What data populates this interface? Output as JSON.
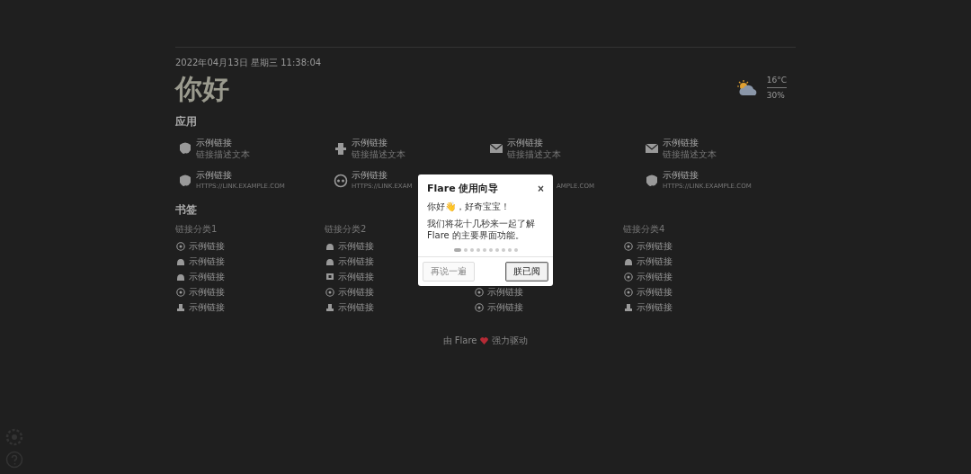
{
  "header": {
    "datetime": "2022年04月13日 星期三 11:38:04",
    "greeting": "你好",
    "weather": {
      "temperature": "16°C",
      "humidity": "30%"
    }
  },
  "apps": {
    "title": "应用",
    "items": [
      {
        "kind": "link",
        "title": "示例链接",
        "description": "链接描述文本"
      },
      {
        "kind": "link",
        "title": "示例链接",
        "description": "链接描述文本"
      },
      {
        "kind": "link",
        "title": "示例链接",
        "description": "链接描述文本"
      },
      {
        "kind": "link",
        "title": "示例链接",
        "description": "链接描述文本"
      },
      {
        "kind": "link",
        "title": "示例链接",
        "description": "HTTPS://LINK.EXAMPLE.COM"
      },
      {
        "kind": "link",
        "title": "示例链接",
        "description": "HTTPS://LINK.EXAM"
      },
      {
        "kind": "fragment",
        "description": "AMPLE.COM"
      },
      {
        "kind": "link",
        "title": "示例链接",
        "description": "HTTPS://LINK.EXAMPLE.COM"
      }
    ]
  },
  "bookmarks": {
    "title": "书签",
    "groups": [
      {
        "title": "链接分类1",
        "links": [
          "示例链接",
          "示例链接",
          "示例链接",
          "示例链接",
          "示例链接"
        ]
      },
      {
        "title": "链接分类2",
        "links": [
          "示例链接",
          "示例链接",
          "示例链接",
          "示例链接",
          "示例链接"
        ]
      },
      {
        "links": [
          "示例链接",
          "示例链接"
        ]
      },
      {
        "title": "链接分类4",
        "links": [
          "示例链接",
          "示例链接",
          "示例链接",
          "示例链接",
          "示例链接"
        ]
      }
    ]
  },
  "footer": {
    "before": "由 Flare",
    "after": "强力驱动"
  },
  "guide": {
    "title": "Flare 使用向导",
    "close": "×",
    "greeting": "你好👋，好奇宝宝！",
    "body": "我们将花十几秒来一起了解 Flare 的主要界面功能。",
    "steps": [
      {
        "selected": true
      },
      {
        "selected": false
      },
      {
        "selected": false
      },
      {
        "selected": false
      },
      {
        "selected": false
      },
      {
        "selected": false
      },
      {
        "selected": false
      },
      {
        "selected": false
      },
      {
        "selected": false
      },
      {
        "selected": false
      }
    ],
    "buttons": [
      {
        "label": "再说一遍",
        "disabled": true
      },
      {
        "label": "朕已阅",
        "disabled": false
      }
    ]
  }
}
